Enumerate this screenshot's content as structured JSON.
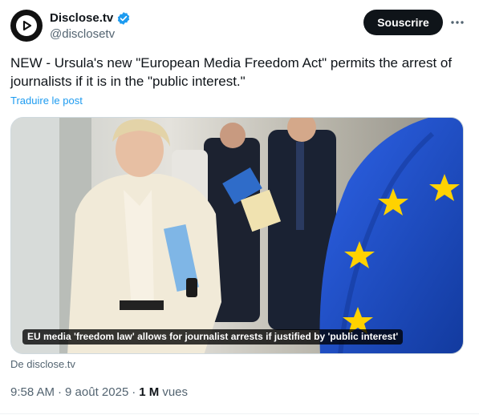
{
  "author": {
    "display_name": "Disclose.tv",
    "handle": "@disclosetv",
    "verified": true,
    "avatar_icon": "play-logo-icon"
  },
  "actions": {
    "subscribe_label": "Souscrire",
    "more_icon": "more-horizontal-icon"
  },
  "post": {
    "text": "NEW - Ursula's new \"European Media Freedom Act\" permits the arrest of journalists if it is in the \"public interest.\"",
    "translate_label": "Traduire le post"
  },
  "media": {
    "caption": "EU media 'freedom law' allows for journalist arrests if justified by 'public interest'",
    "source_label": "De disclose.tv"
  },
  "meta": {
    "time": "9:58 AM",
    "date": "9 août 2025",
    "separator": "·",
    "views_count": "1 M",
    "views_label": "vues"
  },
  "colors": {
    "accent": "#1d9bf0",
    "text_primary": "#0f1419",
    "text_secondary": "#536471",
    "button_bg": "#0f1419",
    "eu_flag_blue": "#1f4fd1",
    "eu_star_yellow": "#ffd200"
  }
}
